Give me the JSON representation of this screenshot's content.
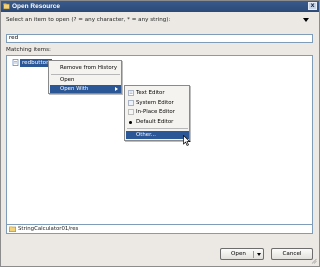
{
  "window": {
    "title": "Open Resource",
    "close_label": "x"
  },
  "prompt": "Select an item to open (? = any character, * = any string):",
  "search": {
    "value": "red"
  },
  "matching_label": "Matching items:",
  "results": [
    {
      "label": "redbutton"
    }
  ],
  "context_menu": {
    "items": [
      "Remove from History",
      "Open",
      "Open With"
    ]
  },
  "open_with_menu": {
    "items": [
      "Text Editor",
      "System Editor",
      "In-Place Editor",
      "Default Editor",
      "Other..."
    ]
  },
  "path": "StringCalculator01/res",
  "buttons": {
    "open": "Open",
    "cancel": "Cancel"
  },
  "colors": {
    "selection": "#2b5797",
    "titlebar": "#2b4a78"
  }
}
